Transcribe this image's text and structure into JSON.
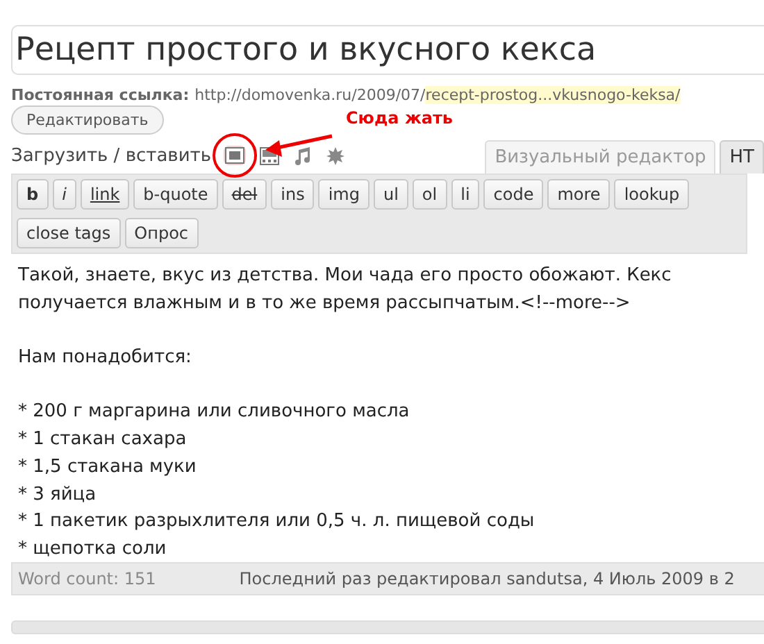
{
  "title": "Рецепт простого и вкусного кекса",
  "permalink": {
    "label": "Постоянная ссылка:",
    "url": "http://domovenka.ru/2009/07/",
    "slug": "recept-prostog...vkusnogo-keksa/",
    "edit_button": "Редактировать"
  },
  "annotation": {
    "text": "Сюда жать"
  },
  "upload": {
    "label": "Загрузить / вставить",
    "media": [
      {
        "kind": "image",
        "highlighted": true
      },
      {
        "kind": "video",
        "highlighted": false
      },
      {
        "kind": "audio",
        "highlighted": false
      },
      {
        "kind": "other",
        "highlighted": false
      }
    ]
  },
  "tabs": [
    {
      "label": "Визуальный редактор",
      "selected": false
    },
    {
      "label": "HT",
      "selected": true
    }
  ],
  "quicktags": [
    {
      "label": "b",
      "kind": "bold"
    },
    {
      "label": "i",
      "kind": "italic"
    },
    {
      "label": "link",
      "kind": "underline"
    },
    {
      "label": "b-quote",
      "kind": "plain"
    },
    {
      "label": "del",
      "kind": "strike"
    },
    {
      "label": "ins",
      "kind": "plain"
    },
    {
      "label": "img",
      "kind": "plain"
    },
    {
      "label": "ul",
      "kind": "plain"
    },
    {
      "label": "ol",
      "kind": "plain"
    },
    {
      "label": "li",
      "kind": "plain"
    },
    {
      "label": "code",
      "kind": "plain"
    },
    {
      "label": "more",
      "kind": "plain"
    },
    {
      "label": "lookup",
      "kind": "plain"
    },
    {
      "label": "close tags",
      "kind": "plain"
    },
    {
      "label": "Опрос",
      "kind": "plain"
    }
  ],
  "content_paragraphs": [
    [
      "Такой, знаете, вкус из детства. Мои чада его просто обожают. Кекс",
      "получается влажным и в то же время рассыпчатым.<!--more-->"
    ],
    [
      "Нам понадобится:"
    ],
    [
      "* 200 г маргарина или сливочного масла",
      "* 1 стакан сахара",
      "* 1,5 стакана муки",
      "* 3 яйца",
      "* 1 пакетик разрыхлителя или 0,5 ч. л. пищевой соды",
      "* щепотка соли"
    ]
  ],
  "status_bar": {
    "word_count": "Word count: 151",
    "last_edited": "Последний раз редактировал sandutsa, 4 Июль 2009 в 2"
  }
}
